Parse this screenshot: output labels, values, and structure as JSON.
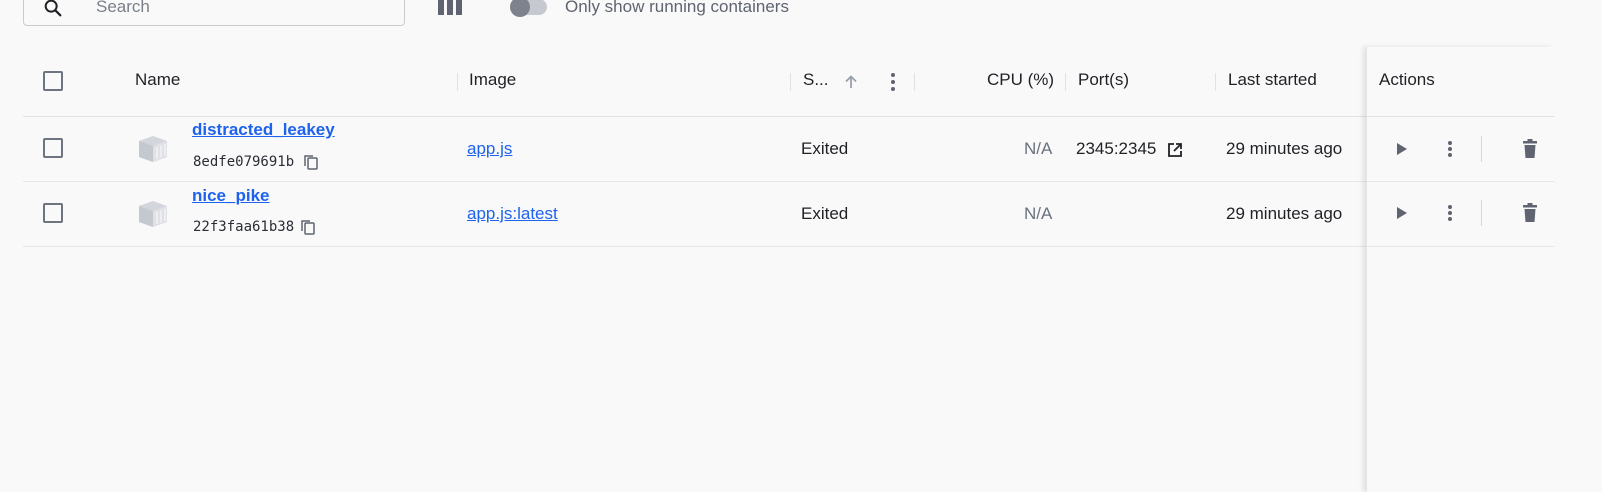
{
  "toolbar": {
    "search_placeholder": "Search",
    "running_only_label": "Only show running containers",
    "running_only_enabled": false
  },
  "table": {
    "headers": {
      "name": "Name",
      "image": "Image",
      "status": "S...",
      "cpu": "CPU (%)",
      "ports": "Port(s)",
      "last_started": "Last started",
      "actions": "Actions"
    },
    "sort": {
      "column": "status",
      "direction": "ascending"
    },
    "rows": [
      {
        "name": "distracted_leakey",
        "id": "8edfe079691b",
        "image": "app.js",
        "status": "Exited",
        "cpu": "N/A",
        "ports": "2345:2345",
        "last_started": "29 minutes ago"
      },
      {
        "name": "nice_pike",
        "id": "22f3faa61b38",
        "image": "app.js:latest",
        "status": "Exited",
        "cpu": "N/A",
        "ports": "",
        "last_started": "29 minutes ago"
      }
    ]
  },
  "colors": {
    "link": "#1d63ed",
    "icon": "#5f6470",
    "background": "#f9f9fa"
  }
}
